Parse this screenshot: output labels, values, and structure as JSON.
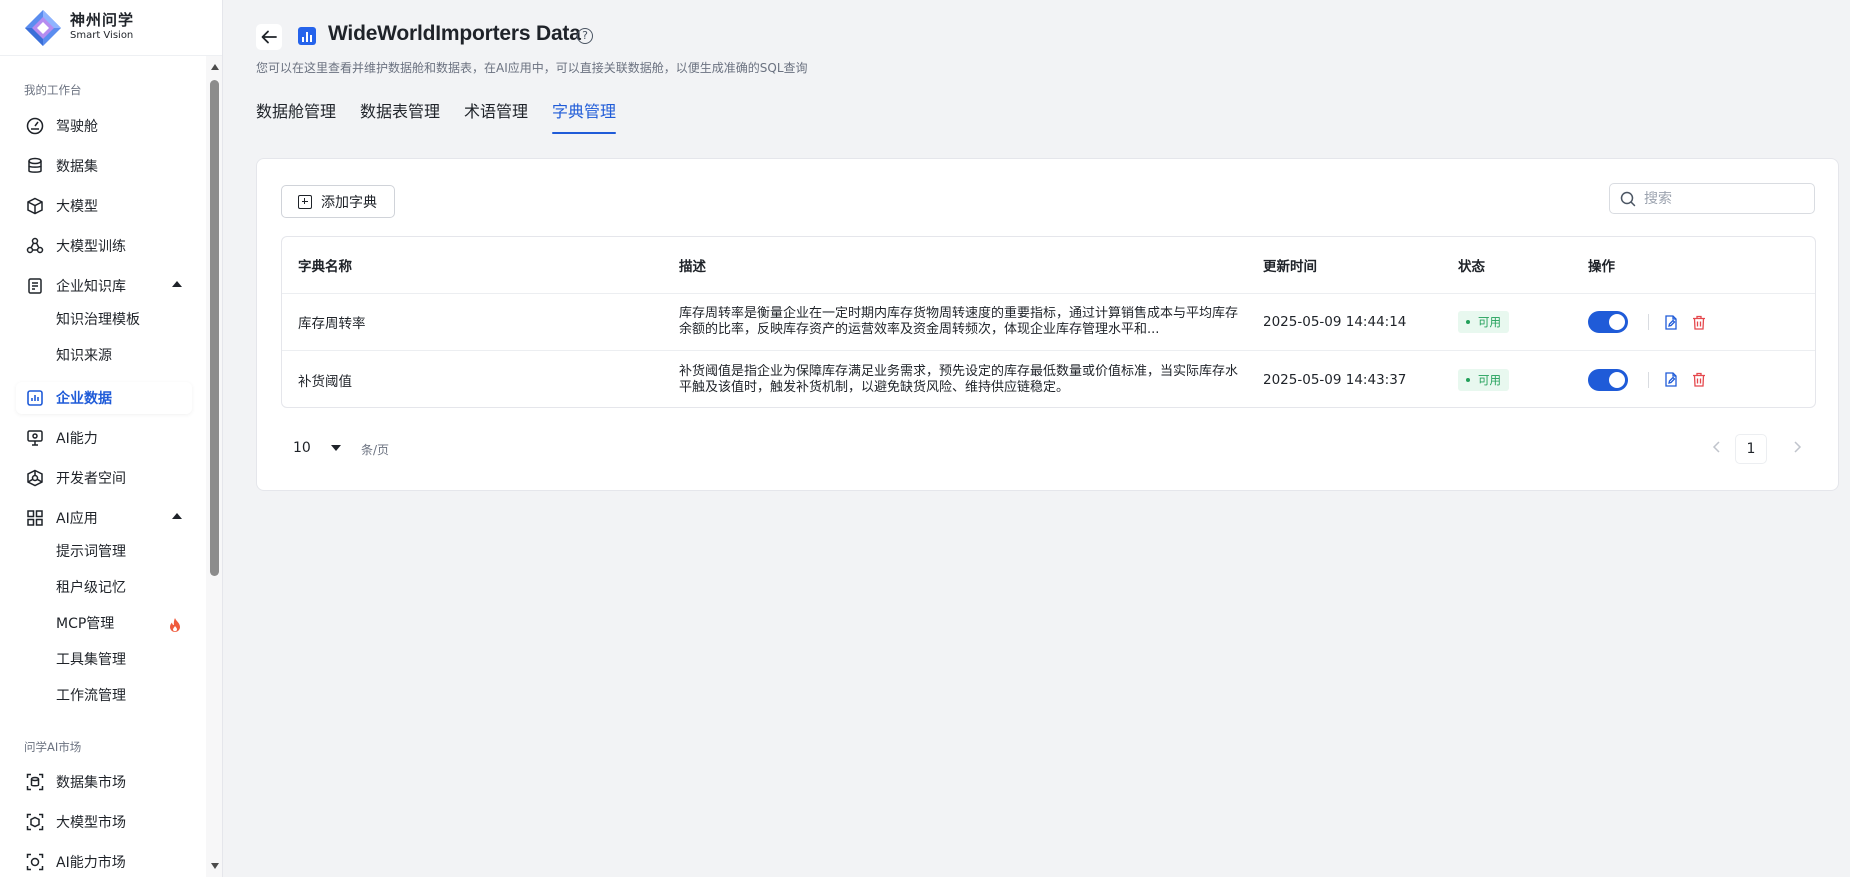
{
  "brand": {
    "name_cn": "神州问学",
    "name_en": "Smart Vision"
  },
  "sidebar": {
    "section_workbench": "我的工作台",
    "items": [
      {
        "label": "驾驶舱",
        "icon": "dashboard-icon"
      },
      {
        "label": "数据集",
        "icon": "database-icon"
      },
      {
        "label": "大模型",
        "icon": "cube-icon"
      },
      {
        "label": "大模型训练",
        "icon": "training-icon"
      },
      {
        "label": "企业知识库",
        "icon": "clipboard-icon",
        "expanded": true
      },
      {
        "label": "企业数据",
        "icon": "bar-chart-icon",
        "active": true
      },
      {
        "label": "AI能力",
        "icon": "ai-monitor-icon"
      },
      {
        "label": "开发者空间",
        "icon": "developer-icon"
      },
      {
        "label": "AI应用",
        "icon": "grid-icon",
        "expanded": true
      }
    ],
    "knowledge_sub": [
      "知识治理模板",
      "知识来源"
    ],
    "app_sub": [
      "提示词管理",
      "租户级记忆",
      "MCP管理",
      "工具集管理",
      "工作流管理"
    ],
    "section_market": "问学AI市场",
    "market_items": [
      {
        "label": "数据集市场",
        "icon": "dataset-market-icon"
      },
      {
        "label": "大模型市场",
        "icon": "model-market-icon"
      },
      {
        "label": "AI能力市场",
        "icon": "ai-market-icon"
      }
    ]
  },
  "header": {
    "title": "WideWorldImporters Data",
    "help": "?",
    "subtitle": "您可以在这里查看并维护数据舱和数据表，在AI应用中，可以直接关联数据舱，以便生成准确的SQL查询"
  },
  "tabs": [
    "数据舱管理",
    "数据表管理",
    "术语管理",
    "字典管理"
  ],
  "active_tab": 3,
  "toolbar": {
    "add_label": "添加字典",
    "search_placeholder": "搜索"
  },
  "table": {
    "columns": [
      "字典名称",
      "描述",
      "更新时间",
      "状态",
      "操作"
    ],
    "rows": [
      {
        "name": "库存周转率",
        "desc": "库存周转率是衡量企业在一定时期内库存货物周转速度的重要指标，通过计算销售成本与平均库存余额的比率，反映库存资产的运营效率及资金周转频次，体现企业库存管理水平和...",
        "time": "2025-05-09 14:44:14",
        "status": "可用",
        "enabled": true
      },
      {
        "name": "补货阈值",
        "desc": "补货阈值是指企业为保障库存满足业务需求，预先设定的库存最低数量或价值标准，当实际库存水平触及该值时，触发补货机制，以避免缺货风险、维持供应链稳定。",
        "time": "2025-05-09 14:43:37",
        "status": "可用",
        "enabled": true
      }
    ]
  },
  "pagination": {
    "page_size": "10",
    "unit": "条/页",
    "current": "1"
  },
  "colors": {
    "accent": "#1f5bd8",
    "success": "#22a05a",
    "danger": "#e5484d"
  }
}
